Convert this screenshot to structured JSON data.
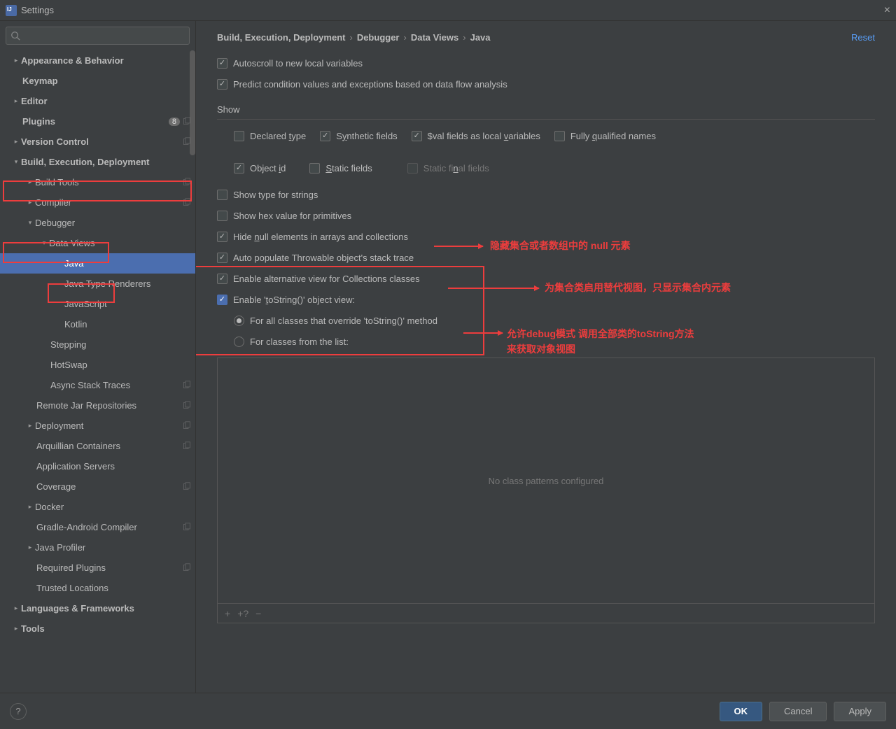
{
  "window": {
    "title": "Settings"
  },
  "search": {
    "placeholder": ""
  },
  "sidebar": {
    "items": [
      {
        "label": "Appearance & Behavior",
        "bold": true,
        "expand": true,
        "chev": ">",
        "ind": "ind0"
      },
      {
        "label": "Keymap",
        "bold": true,
        "ind": "leaf0"
      },
      {
        "label": "Editor",
        "bold": true,
        "expand": true,
        "chev": ">",
        "ind": "ind0"
      },
      {
        "label": "Plugins",
        "bold": true,
        "badge": "8",
        "copy": true,
        "ind": "leaf0"
      },
      {
        "label": "Version Control",
        "bold": true,
        "expand": true,
        "chev": ">",
        "copy": true,
        "ind": "ind0"
      },
      {
        "label": "Build, Execution, Deployment",
        "bold": true,
        "expand": true,
        "chev": "v",
        "ind": "ind0"
      },
      {
        "label": "Build Tools",
        "expand": true,
        "chev": ">",
        "copy": true,
        "ind": "ind1"
      },
      {
        "label": "Compiler",
        "expand": true,
        "chev": ">",
        "copy": true,
        "ind": "ind1"
      },
      {
        "label": "Debugger",
        "expand": true,
        "chev": "v",
        "ind": "ind1"
      },
      {
        "label": "Data Views",
        "expand": true,
        "chev": "v",
        "ind": "ind2"
      },
      {
        "label": "Java",
        "ind": "leaf3",
        "selected": true
      },
      {
        "label": "Java Type Renderers",
        "ind": "leaf3"
      },
      {
        "label": "JavaScript",
        "ind": "leaf3"
      },
      {
        "label": "Kotlin",
        "ind": "leaf3"
      },
      {
        "label": "Stepping",
        "ind": "leaf2"
      },
      {
        "label": "HotSwap",
        "ind": "leaf2"
      },
      {
        "label": "Async Stack Traces",
        "copy": true,
        "ind": "leaf2"
      },
      {
        "label": "Remote Jar Repositories",
        "copy": true,
        "ind": "leaf1"
      },
      {
        "label": "Deployment",
        "expand": true,
        "chev": ">",
        "copy": true,
        "ind": "ind1"
      },
      {
        "label": "Arquillian Containers",
        "copy": true,
        "ind": "leaf1"
      },
      {
        "label": "Application Servers",
        "ind": "leaf1"
      },
      {
        "label": "Coverage",
        "copy": true,
        "ind": "leaf1"
      },
      {
        "label": "Docker",
        "expand": true,
        "chev": ">",
        "ind": "ind1"
      },
      {
        "label": "Gradle-Android Compiler",
        "copy": true,
        "ind": "leaf1"
      },
      {
        "label": "Java Profiler",
        "expand": true,
        "chev": ">",
        "ind": "ind1"
      },
      {
        "label": "Required Plugins",
        "copy": true,
        "ind": "leaf1"
      },
      {
        "label": "Trusted Locations",
        "ind": "leaf1"
      },
      {
        "label": "Languages & Frameworks",
        "bold": true,
        "expand": true,
        "chev": ">",
        "ind": "ind0"
      },
      {
        "label": "Tools",
        "bold": true,
        "expand": true,
        "chev": ">",
        "ind": "ind0"
      }
    ]
  },
  "breadcrumb": {
    "a": "Build, Execution, Deployment",
    "b": "Debugger",
    "c": "Data Views",
    "d": "Java",
    "reset": "Reset"
  },
  "opts": {
    "autoscroll": "Autoscroll to new local variables",
    "predict": "Predict condition values and exceptions based on data flow analysis",
    "show_label": "Show",
    "declared_type": "Declared type",
    "synthetic": "Synthetic fields",
    "valfields": "$val fields as local variables",
    "fqn": "Fully qualified names",
    "objectid": "Object id",
    "staticf": "Static fields",
    "staticfinal": "Static final fields",
    "showtype": "Show type for strings",
    "showhex": "Show hex value for primitives",
    "hidenull": "Hide null elements in arrays and collections",
    "autothrow": "Auto populate Throwable object's stack trace",
    "enablealt": "Enable alternative view for Collections classes",
    "enabletostr": "Enable 'toString()' object view:",
    "radio_all": "For all classes that override 'toString()' method",
    "radio_list": "For classes from the list:",
    "listempty": "No class patterns configured"
  },
  "annotations": {
    "a1": "隐藏集合或者数组中的 null 元素",
    "a2": "为集合类启用替代视图，只显示集合内元素",
    "a3a": "允许debug模式 调用全部类的toString方法",
    "a3b": "来获取对象视图"
  },
  "footer": {
    "ok": "OK",
    "cancel": "Cancel",
    "apply": "Apply"
  }
}
